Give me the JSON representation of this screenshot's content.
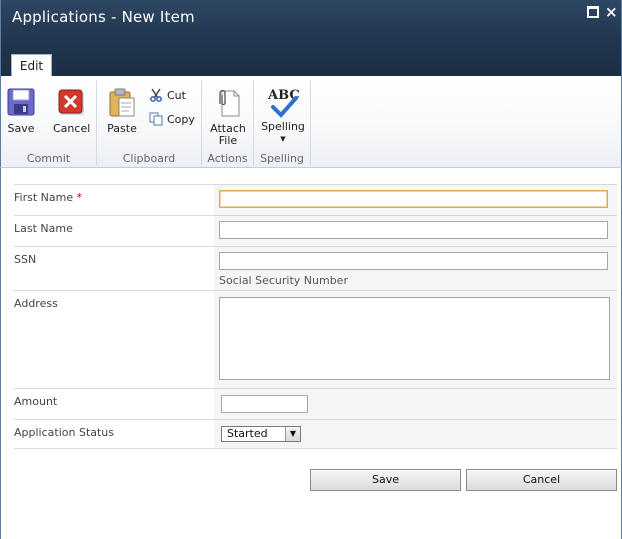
{
  "window": {
    "title": "Applications - New Item"
  },
  "ribbon": {
    "tabs": [
      {
        "label": "Edit",
        "selected": true
      }
    ],
    "groups": {
      "commit": {
        "label": "Commit",
        "save_label": "Save",
        "cancel_label": "Cancel"
      },
      "clipboard": {
        "label": "Clipboard",
        "paste_label": "Paste",
        "cut_label": "Cut",
        "copy_label": "Copy"
      },
      "actions": {
        "label": "Actions",
        "attach_label_1": "Attach",
        "attach_label_2": "File"
      },
      "spelling": {
        "label": "Spelling",
        "spelling_label": "Spelling",
        "spelling_icon_text": "ABC"
      }
    }
  },
  "form": {
    "first_name": {
      "label": "First Name",
      "required_marker": "*",
      "value": ""
    },
    "last_name": {
      "label": "Last Name",
      "value": ""
    },
    "ssn": {
      "label": "SSN",
      "value": "",
      "hint": "Social Security Number"
    },
    "address": {
      "label": "Address",
      "value": ""
    },
    "amount": {
      "label": "Amount",
      "value": ""
    },
    "status": {
      "label": "Application Status",
      "selected": "Started"
    }
  },
  "buttons": {
    "save": "Save",
    "cancel": "Cancel"
  },
  "colors": {
    "titlebar": "#21364e",
    "required": "#cc0000",
    "focus_border": "#e3a857"
  }
}
